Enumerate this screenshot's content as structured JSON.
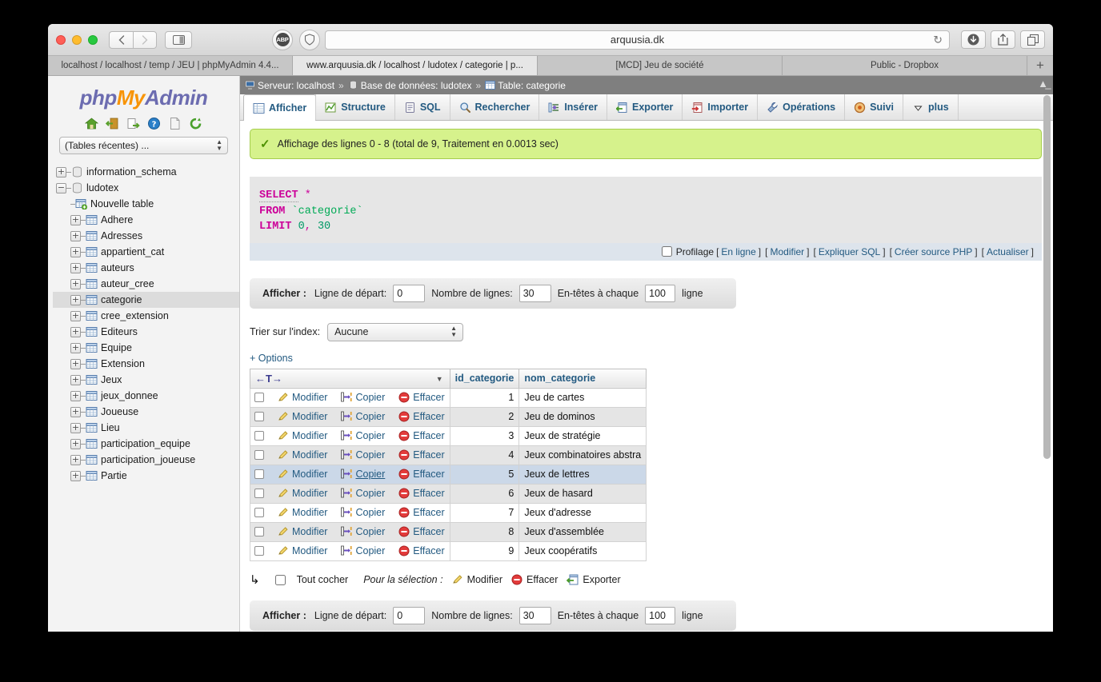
{
  "browser": {
    "url": "arquusia.dk",
    "icons": {
      "back": "back-chevron-icon",
      "forward": "forward-chevron-icon",
      "sidebar": "sidebar-toggle-icon",
      "adblock": "ABP",
      "shield": "shield-icon",
      "reload": "↻",
      "download": "download-icon",
      "share": "share-icon",
      "tabs": "tab-overview-icon",
      "newtab": "+"
    },
    "tabs": [
      {
        "title": "localhost / localhost / temp / JEU | phpMyAdmin 4.4...",
        "active": false
      },
      {
        "title": "www.arquusia.dk / localhost / ludotex / categorie | p...",
        "active": true
      },
      {
        "title": "[MCD] Jeu de société",
        "active": false
      },
      {
        "title": "Public - Dropbox",
        "active": false
      }
    ]
  },
  "sidebar": {
    "logo": {
      "php": "php",
      "my": "My",
      "admin": "Admin"
    },
    "tools": [
      {
        "name": "home-icon",
        "title": "Accueil"
      },
      {
        "name": "logout-icon",
        "title": "Déconnexion"
      },
      {
        "name": "export-icon",
        "title": "Exporter"
      },
      {
        "name": "help-icon",
        "title": "Aide"
      },
      {
        "name": "docs-icon",
        "title": "Documentation"
      },
      {
        "name": "reload-icon",
        "title": "Actualiser"
      }
    ],
    "recent_selector": "(Tables récentes) ...",
    "tree": [
      {
        "label": "information_schema",
        "level": 1,
        "toggle": "+",
        "icon": "db-icon",
        "selected": false
      },
      {
        "label": "ludotex",
        "level": 1,
        "toggle": "−",
        "icon": "db-icon",
        "selected": false
      },
      {
        "label": "Nouvelle table",
        "level": 2,
        "toggle": "",
        "icon": "new-table-icon",
        "selected": false
      },
      {
        "label": "Adhere",
        "level": 2,
        "toggle": "+",
        "icon": "table-icon",
        "selected": false
      },
      {
        "label": "Adresses",
        "level": 2,
        "toggle": "+",
        "icon": "table-icon",
        "selected": false
      },
      {
        "label": "appartient_cat",
        "level": 2,
        "toggle": "+",
        "icon": "table-icon",
        "selected": false
      },
      {
        "label": "auteurs",
        "level": 2,
        "toggle": "+",
        "icon": "table-icon",
        "selected": false
      },
      {
        "label": "auteur_cree",
        "level": 2,
        "toggle": "+",
        "icon": "table-icon",
        "selected": false
      },
      {
        "label": "categorie",
        "level": 2,
        "toggle": "+",
        "icon": "table-icon",
        "selected": true
      },
      {
        "label": "cree_extension",
        "level": 2,
        "toggle": "+",
        "icon": "table-icon",
        "selected": false
      },
      {
        "label": "Editeurs",
        "level": 2,
        "toggle": "+",
        "icon": "table-icon",
        "selected": false
      },
      {
        "label": "Equipe",
        "level": 2,
        "toggle": "+",
        "icon": "table-icon",
        "selected": false
      },
      {
        "label": "Extension",
        "level": 2,
        "toggle": "+",
        "icon": "table-icon",
        "selected": false
      },
      {
        "label": "Jeux",
        "level": 2,
        "toggle": "+",
        "icon": "table-icon",
        "selected": false
      },
      {
        "label": "jeux_donnee",
        "level": 2,
        "toggle": "+",
        "icon": "table-icon",
        "selected": false
      },
      {
        "label": "Joueuse",
        "level": 2,
        "toggle": "+",
        "icon": "table-icon",
        "selected": false
      },
      {
        "label": "Lieu",
        "level": 2,
        "toggle": "+",
        "icon": "table-icon",
        "selected": false
      },
      {
        "label": "participation_equipe",
        "level": 2,
        "toggle": "+",
        "icon": "table-icon",
        "selected": false
      },
      {
        "label": "participation_joueuse",
        "level": 2,
        "toggle": "+",
        "icon": "table-icon",
        "selected": false
      },
      {
        "label": "Partie",
        "level": 2,
        "toggle": "+",
        "icon": "table-icon",
        "selected": false
      }
    ]
  },
  "breadcrumb": {
    "server_label": "Serveur: localhost",
    "db_label": "Base de données: ludotex",
    "table_label": "Table: categorie",
    "separator": "»",
    "collapse_icon": "collapse-icon"
  },
  "nav_tabs": [
    {
      "label": "Afficher",
      "icon": "browse-icon",
      "active": true
    },
    {
      "label": "Structure",
      "icon": "structure-icon",
      "active": false
    },
    {
      "label": "SQL",
      "icon": "sql-icon",
      "active": false
    },
    {
      "label": "Rechercher",
      "icon": "search-icon",
      "active": false
    },
    {
      "label": "Insérer",
      "icon": "insert-icon",
      "active": false
    },
    {
      "label": "Exporter",
      "icon": "export-icon",
      "active": false
    },
    {
      "label": "Importer",
      "icon": "import-icon",
      "active": false
    },
    {
      "label": "Opérations",
      "icon": "operations-icon",
      "active": false
    },
    {
      "label": "Suivi",
      "icon": "tracking-icon",
      "active": false
    },
    {
      "label": "plus",
      "icon": "chevron-down-icon",
      "active": false
    }
  ],
  "success_message": "Affichage des lignes 0 - 8 (total de 9, Traitement en 0.0013 sec)",
  "sql": {
    "kw_select": "SELECT",
    "star": "*",
    "kw_from": "FROM",
    "table": "`categorie`",
    "kw_limit": "LIMIT",
    "limit_start": "0",
    "limit_comma": ",",
    "limit_count": "30"
  },
  "profiling": {
    "label": "Profilage",
    "links": [
      "En ligne",
      "Modifier",
      "Expliquer SQL",
      "Créer source PHP",
      "Actualiser"
    ]
  },
  "display_bar": {
    "title": "Afficher :",
    "start_label": "Ligne de départ:",
    "start_value": "0",
    "rows_label": "Nombre de lignes:",
    "rows_value": "30",
    "headers_label": "En-têtes à chaque",
    "headers_value": "100",
    "headers_suffix": "ligne"
  },
  "sort_index": {
    "label": "Trier sur l'index:",
    "value": "Aucune"
  },
  "options_link": "+ Options",
  "results_table": {
    "action_header": "←T→",
    "columns": [
      "id_categorie",
      "nom_categorie"
    ],
    "actions": {
      "edit": "Modifier",
      "copy": "Copier",
      "delete": "Effacer"
    },
    "rows": [
      {
        "id": "1",
        "nom": "Jeu de cartes",
        "highlight": false
      },
      {
        "id": "2",
        "nom": "Jeu de dominos",
        "highlight": false
      },
      {
        "id": "3",
        "nom": "Jeux de stratégie",
        "highlight": false
      },
      {
        "id": "4",
        "nom": "Jeux combinatoires abstra",
        "highlight": false
      },
      {
        "id": "5",
        "nom": "Jeux de lettres",
        "highlight": true
      },
      {
        "id": "6",
        "nom": "Jeux de hasard",
        "highlight": false
      },
      {
        "id": "7",
        "nom": "Jeux d'adresse",
        "highlight": false
      },
      {
        "id": "8",
        "nom": "Jeux d'assemblée",
        "highlight": false
      },
      {
        "id": "9",
        "nom": "Jeux coopératifs",
        "highlight": false
      }
    ]
  },
  "selection_bar": {
    "check_all": "Tout cocher",
    "for_selection": "Pour la sélection :",
    "edit": "Modifier",
    "delete": "Effacer",
    "export": "Exporter"
  },
  "display_bar_bottom": {
    "title": "Afficher :",
    "start_label": "Ligne de départ:",
    "start_value": "0",
    "rows_label": "Nombre de lignes:",
    "rows_value": "30",
    "headers_label": "En-têtes à chaque",
    "headers_value": "100",
    "headers_suffix": "ligne"
  },
  "colors": {
    "accent_link": "#235a81",
    "success_bg": "#d6f28c",
    "success_border": "#a5cd4e",
    "breadcrumb_bg": "#7f7f7f",
    "sql_keyword": "#cc0099",
    "sql_string": "#00aa55",
    "row_highlight": "#cbd8e8",
    "logo_orange": "#f89406",
    "logo_purple": "#6c6cb0"
  }
}
